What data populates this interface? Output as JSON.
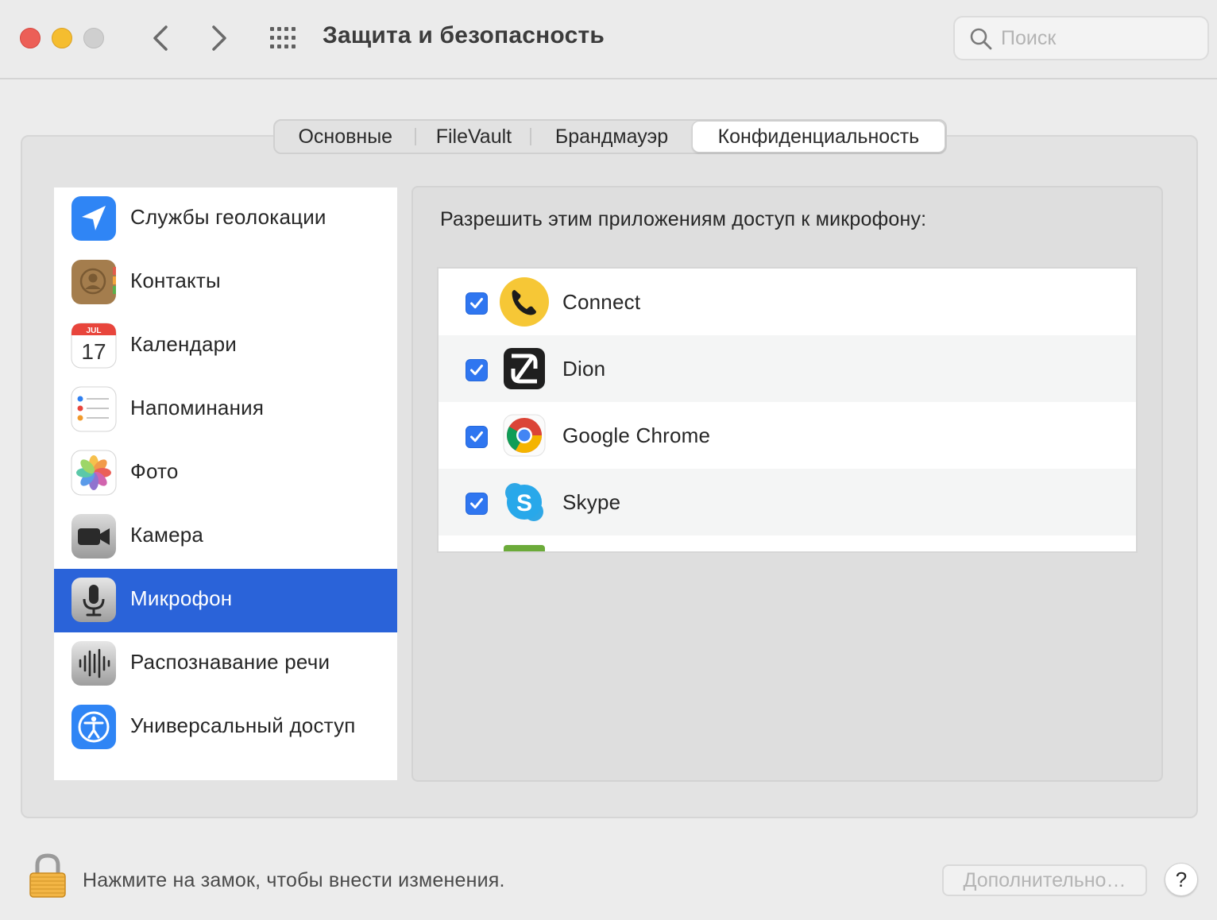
{
  "window": {
    "title": "Защита и безопасность",
    "search": {
      "placeholder": "Поиск",
      "value": ""
    }
  },
  "tabs": [
    {
      "label": "Основные",
      "active": false
    },
    {
      "label": "FileVault",
      "active": false
    },
    {
      "label": "Брандмауэр",
      "active": false
    },
    {
      "label": "Конфиденциальность",
      "active": true
    }
  ],
  "sidebar": {
    "items": [
      {
        "label": "Службы геолокации",
        "icon": "location-arrow-icon"
      },
      {
        "label": "Контакты",
        "icon": "contacts-icon"
      },
      {
        "label": "Календари",
        "icon": "calendar-icon",
        "calendar_month": "JUL",
        "calendar_day": "17"
      },
      {
        "label": "Напоминания",
        "icon": "reminders-icon"
      },
      {
        "label": "Фото",
        "icon": "photos-icon"
      },
      {
        "label": "Камера",
        "icon": "camera-icon"
      },
      {
        "label": "Микрофон",
        "icon": "microphone-icon",
        "selected": true
      },
      {
        "label": "Распознавание речи",
        "icon": "speech-recognition-icon"
      },
      {
        "label": "Универсальный доступ",
        "icon": "accessibility-icon"
      }
    ]
  },
  "content": {
    "heading": "Разрешить этим приложениям доступ к микрофону:",
    "apps": [
      {
        "name": "Connect",
        "checked": true,
        "icon": "connect-phone-icon"
      },
      {
        "name": "Dion",
        "checked": true,
        "icon": "dion-icon"
      },
      {
        "name": "Google Chrome",
        "checked": true,
        "icon": "chrome-icon"
      },
      {
        "name": "Skype",
        "checked": true,
        "icon": "skype-icon"
      }
    ]
  },
  "footer": {
    "lock_text": "Нажмите на замок, чтобы внести изменения.",
    "advanced_label": "Дополнительно…",
    "help_label": "?"
  },
  "colors": {
    "selection": "#2a63d9",
    "checkbox": "#2f76f0",
    "close": "#ec5f57",
    "minimize": "#f5bd2f",
    "zoom": "#cfcfcf"
  }
}
